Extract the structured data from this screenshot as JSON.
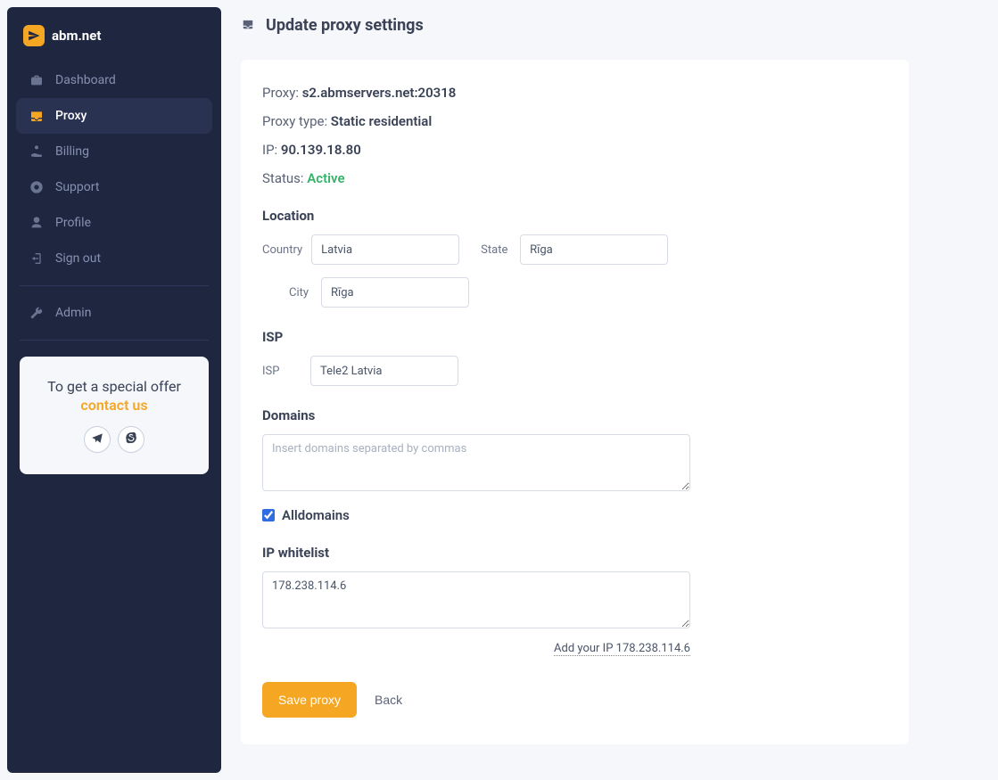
{
  "brand": "abm.net",
  "nav": {
    "dashboard": "Dashboard",
    "proxy": "Proxy",
    "billing": "Billing",
    "support": "Support",
    "profile": "Profile",
    "signout": "Sign out",
    "admin": "Admin"
  },
  "offer": {
    "title": "To get a special offer",
    "link": "contact us"
  },
  "page": {
    "title": "Update proxy settings"
  },
  "info": {
    "proxy_label": "Proxy: ",
    "proxy_value": "s2.abmservers.net:20318",
    "type_label": "Proxy type: ",
    "type_value": "Static residential",
    "ip_label": "IP: ",
    "ip_value": "90.139.18.80",
    "status_label": "Status: ",
    "status_value": "Active"
  },
  "location": {
    "section": "Location",
    "country_label": "Country",
    "country_value": "Latvia",
    "state_label": "State",
    "state_value": "Rīga",
    "city_label": "City",
    "city_value": "Rīga"
  },
  "isp": {
    "section": "ISP",
    "label": "ISP",
    "value": "Tele2 Latvia"
  },
  "domains": {
    "section": "Domains",
    "placeholder": "Insert domains separated by commas",
    "value": "",
    "all_label": "Alldomains",
    "all_checked": true
  },
  "whitelist": {
    "section": "IP whitelist",
    "value": "178.238.114.6",
    "add_link": "Add your IP 178.238.114.6"
  },
  "actions": {
    "save": "Save proxy",
    "back": "Back"
  }
}
